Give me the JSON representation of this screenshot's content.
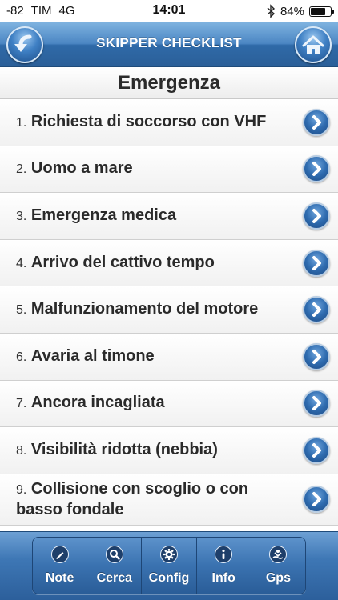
{
  "status_bar": {
    "signal": "-82",
    "carrier": "TIM",
    "network": "4G",
    "time": "14:01",
    "battery_text": "84%",
    "battery_level": 0.84
  },
  "header": {
    "title": "SKIPPER CHECKLIST",
    "back_icon": "back-arrow-icon",
    "home_icon": "home-icon"
  },
  "section": {
    "title": "Emergenza"
  },
  "items": [
    {
      "num": "1.",
      "label": "Richiesta di soccorso con VHF"
    },
    {
      "num": "2.",
      "label": "Uomo a mare"
    },
    {
      "num": "3.",
      "label": "Emergenza medica"
    },
    {
      "num": "4.",
      "label": "Arrivo del cattivo tempo"
    },
    {
      "num": "5.",
      "label": "Malfunzionamento del motore"
    },
    {
      "num": "6.",
      "label": "Avaria al timone"
    },
    {
      "num": "7.",
      "label": "Ancora incagliata"
    },
    {
      "num": "8.",
      "label": "Visibilità ridotta (nebbia)"
    },
    {
      "num": "9.",
      "label": "Collisione con scoglio o con basso fondale"
    }
  ],
  "toolbar": {
    "tabs": [
      {
        "label": "Note",
        "icon": "pencil-icon"
      },
      {
        "label": "Cerca",
        "icon": "search-icon"
      },
      {
        "label": "Config",
        "icon": "gear-icon"
      },
      {
        "label": "Info",
        "icon": "info-icon"
      },
      {
        "label": "Gps",
        "icon": "gps-icon"
      }
    ]
  },
  "colors": {
    "accent": "#2f6aa8",
    "header_light": "#7fb3e0",
    "text": "#2a2a2a"
  }
}
